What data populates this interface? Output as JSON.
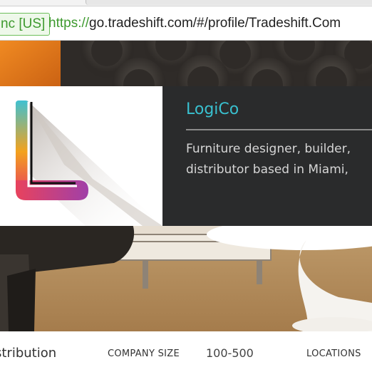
{
  "browser": {
    "ev_badge": "nc [US]",
    "url_protocol": "https://",
    "url_rest": "go.tradeshift.com/#/profile/Tradeshift.Com"
  },
  "profile": {
    "company_name": "LogiCo",
    "description": "Furniture designer, builder,\ndistributor based in Miami,"
  },
  "stats": {
    "industry_value": "istribution",
    "company_size_label": "COMPANY SIZE",
    "company_size_value": "100-500",
    "locations_label": "LOCATIONS"
  },
  "colors": {
    "accent": "#39c0cf",
    "panel": "#2a2b2c",
    "secure_green": "#3e9a2f"
  }
}
